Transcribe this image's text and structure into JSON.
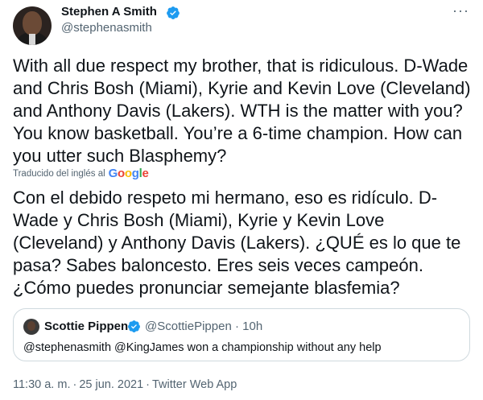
{
  "author": {
    "name": "Stephen A Smith",
    "handle": "@stephenasmith",
    "verified": true
  },
  "tweet": {
    "text": "With all due respect my brother, that is ridiculous. D-Wade and Chris Bosh (Miami), Kyrie and Kevin Love (Cleveland) and Anthony Davis (Lakers). WTH is the matter with you? You know basketball. You’re a 6-time champion. How can you utter such Blasphemy?",
    "translated_label": "Traducido del inglés al",
    "translation_provider": "Google",
    "translation": "Con el debido respeto mi hermano, eso es ridículo. D-Wade y Chris Bosh (Miami), Kyrie y Kevin Love (Cleveland) y Anthony Davis (Lakers). ¿QUÉ es lo que te pasa? Sabes baloncesto. Eres seis veces campeón. ¿Cómo puedes pronunciar semejante blasfemia?"
  },
  "quoted_tweet": {
    "name": "Scottie Pippen",
    "handle": "@ScottiePippen",
    "time": "10h",
    "text": "@stephenasmith @KingJames won a championship without any help",
    "verified": true
  },
  "meta": {
    "time": "11:30 a. m.",
    "date": "25 jun. 2021",
    "source": "Twitter Web App"
  },
  "colors": {
    "verified": "#1d9bf0",
    "secondary_text": "#536471",
    "border": "#cfd9de"
  }
}
